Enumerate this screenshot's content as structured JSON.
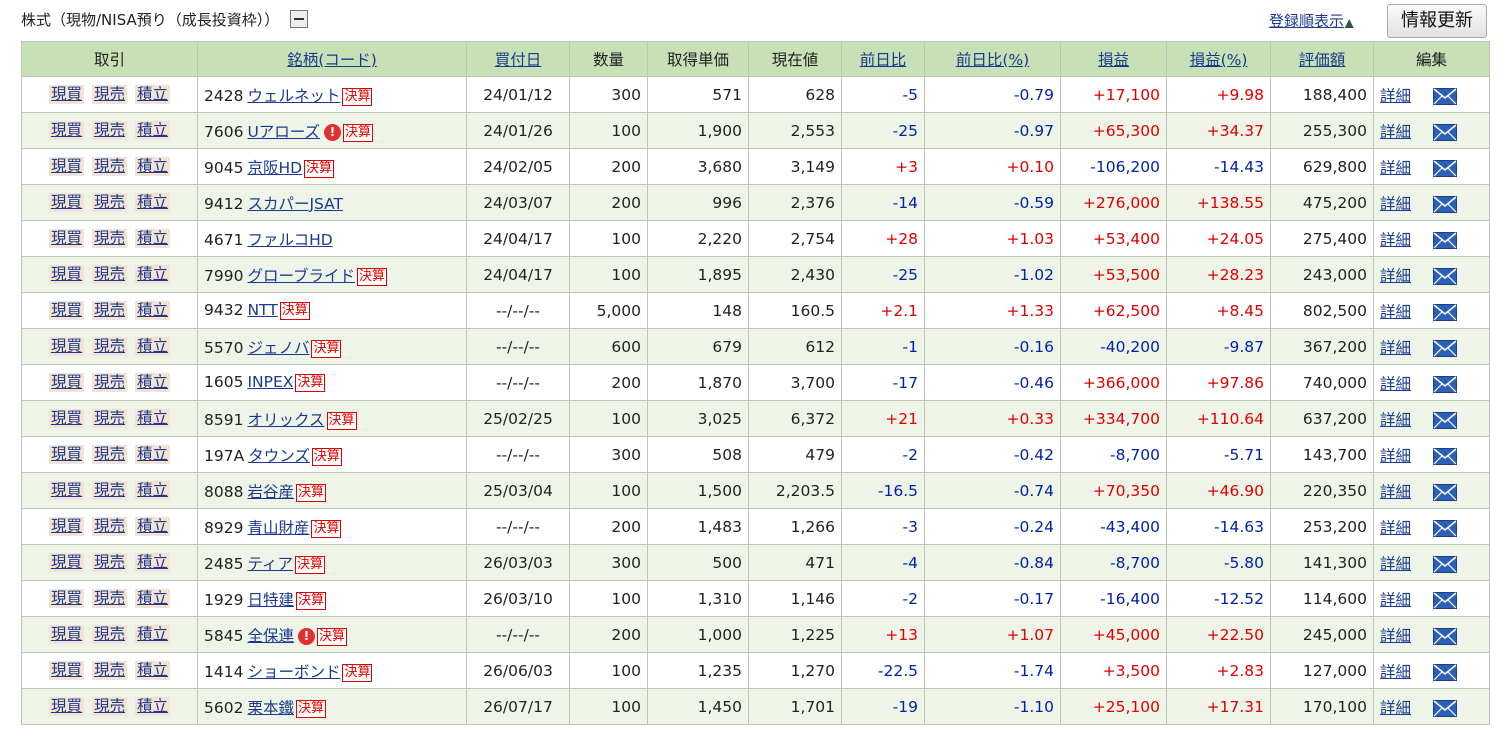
{
  "header": {
    "title": "株式（現物/NISA預り（成長投資枠））",
    "sort_label": "登録順表示",
    "refresh_label": "情報更新"
  },
  "table": {
    "columns": [
      "取引",
      "銘柄(コード)",
      "買付日",
      "数量",
      "取得単価",
      "現在値",
      "前日比",
      "前日比(%)",
      "損益",
      "損益(%)",
      "評価額",
      "編集"
    ],
    "trade_labels": [
      "現買",
      "現売",
      "積立"
    ],
    "kessan_label": "決算",
    "detail_label": "詳細",
    "rows": [
      {
        "code": "2428",
        "name": "ウェルネット",
        "alert": false,
        "date": "24/01/12",
        "qty": "300",
        "cost": "571",
        "price": "628",
        "chg": "-5",
        "chg_pct": "-0.79",
        "pl": "+17,100",
        "pl_pct": "+9.98",
        "value": "188,400"
      },
      {
        "code": "7606",
        "name": "Uアローズ",
        "alert": true,
        "date": "24/01/26",
        "qty": "100",
        "cost": "1,900",
        "price": "2,553",
        "chg": "-25",
        "chg_pct": "-0.97",
        "pl": "+65,300",
        "pl_pct": "+34.37",
        "value": "255,300"
      },
      {
        "code": "9045",
        "name": "京阪HD",
        "alert": false,
        "date": "24/02/05",
        "qty": "200",
        "cost": "3,680",
        "price": "3,149",
        "chg": "+3",
        "chg_pct": "+0.10",
        "pl": "-106,200",
        "pl_pct": "-14.43",
        "value": "629,800"
      },
      {
        "code": "9412",
        "name": "スカパーJSAT",
        "alert": false,
        "kessan": false,
        "date": "24/03/07",
        "qty": "200",
        "cost": "996",
        "price": "2,376",
        "chg": "-14",
        "chg_pct": "-0.59",
        "pl": "+276,000",
        "pl_pct": "+138.55",
        "value": "475,200"
      },
      {
        "code": "4671",
        "name": "ファルコHD",
        "alert": false,
        "kessan": false,
        "date": "24/04/17",
        "qty": "100",
        "cost": "2,220",
        "price": "2,754",
        "chg": "+28",
        "chg_pct": "+1.03",
        "pl": "+53,400",
        "pl_pct": "+24.05",
        "value": "275,400"
      },
      {
        "code": "7990",
        "name": "グローブライド",
        "alert": false,
        "date": "24/04/17",
        "qty": "100",
        "cost": "1,895",
        "price": "2,430",
        "chg": "-25",
        "chg_pct": "-1.02",
        "pl": "+53,500",
        "pl_pct": "+28.23",
        "value": "243,000"
      },
      {
        "code": "9432",
        "name": "NTT",
        "alert": false,
        "date": "--/--/--",
        "qty": "5,000",
        "cost": "148",
        "price": "160.5",
        "chg": "+2.1",
        "chg_pct": "+1.33",
        "pl": "+62,500",
        "pl_pct": "+8.45",
        "value": "802,500"
      },
      {
        "code": "5570",
        "name": "ジェノバ",
        "alert": false,
        "date": "--/--/--",
        "qty": "600",
        "cost": "679",
        "price": "612",
        "chg": "-1",
        "chg_pct": "-0.16",
        "pl": "-40,200",
        "pl_pct": "-9.87",
        "value": "367,200"
      },
      {
        "code": "1605",
        "name": "INPEX",
        "alert": false,
        "date": "--/--/--",
        "qty": "200",
        "cost": "1,870",
        "price": "3,700",
        "chg": "-17",
        "chg_pct": "-0.46",
        "pl": "+366,000",
        "pl_pct": "+97.86",
        "value": "740,000"
      },
      {
        "code": "8591",
        "name": "オリックス",
        "alert": false,
        "date": "25/02/25",
        "qty": "100",
        "cost": "3,025",
        "price": "6,372",
        "chg": "+21",
        "chg_pct": "+0.33",
        "pl": "+334,700",
        "pl_pct": "+110.64",
        "value": "637,200"
      },
      {
        "code": "197A",
        "name": "タウンズ",
        "alert": false,
        "date": "--/--/--",
        "qty": "300",
        "cost": "508",
        "price": "479",
        "chg": "-2",
        "chg_pct": "-0.42",
        "pl": "-8,700",
        "pl_pct": "-5.71",
        "value": "143,700"
      },
      {
        "code": "8088",
        "name": "岩谷産",
        "alert": false,
        "date": "25/03/04",
        "qty": "100",
        "cost": "1,500",
        "price": "2,203.5",
        "chg": "-16.5",
        "chg_pct": "-0.74",
        "pl": "+70,350",
        "pl_pct": "+46.90",
        "value": "220,350"
      },
      {
        "code": "8929",
        "name": "青山財産",
        "alert": false,
        "date": "--/--/--",
        "qty": "200",
        "cost": "1,483",
        "price": "1,266",
        "chg": "-3",
        "chg_pct": "-0.24",
        "pl": "-43,400",
        "pl_pct": "-14.63",
        "value": "253,200"
      },
      {
        "code": "2485",
        "name": "ティア",
        "alert": false,
        "date": "26/03/03",
        "qty": "300",
        "cost": "500",
        "price": "471",
        "chg": "-4",
        "chg_pct": "-0.84",
        "pl": "-8,700",
        "pl_pct": "-5.80",
        "value": "141,300"
      },
      {
        "code": "1929",
        "name": "日特建",
        "alert": false,
        "date": "26/03/10",
        "qty": "100",
        "cost": "1,310",
        "price": "1,146",
        "chg": "-2",
        "chg_pct": "-0.17",
        "pl": "-16,400",
        "pl_pct": "-12.52",
        "value": "114,600"
      },
      {
        "code": "5845",
        "name": "全保連",
        "alert": true,
        "date": "--/--/--",
        "qty": "200",
        "cost": "1,000",
        "price": "1,225",
        "chg": "+13",
        "chg_pct": "+1.07",
        "pl": "+45,000",
        "pl_pct": "+22.50",
        "value": "245,000"
      },
      {
        "code": "1414",
        "name": "ショーボンド",
        "alert": false,
        "date": "26/06/03",
        "qty": "100",
        "cost": "1,235",
        "price": "1,270",
        "chg": "-22.5",
        "chg_pct": "-1.74",
        "pl": "+3,500",
        "pl_pct": "+2.83",
        "value": "127,000"
      },
      {
        "code": "5602",
        "name": "栗本鐵",
        "alert": false,
        "date": "26/07/17",
        "qty": "100",
        "cost": "1,450",
        "price": "1,701",
        "chg": "-19",
        "chg_pct": "-1.10",
        "pl": "+25,100",
        "pl_pct": "+17.31",
        "value": "170,100"
      }
    ]
  },
  "colors": {
    "header_bg": "#c7e0b6",
    "row_alt_bg": "#eef5e8",
    "link": "#1a3a8f",
    "positive": "#e00000",
    "negative": "#0022aa",
    "kessan_badge": "#dd0000"
  },
  "icons": {
    "collapse": "minus-box-icon",
    "sort": "triangle-up-icon",
    "alert": "exclamation-circle-icon",
    "mail": "envelope-icon"
  }
}
